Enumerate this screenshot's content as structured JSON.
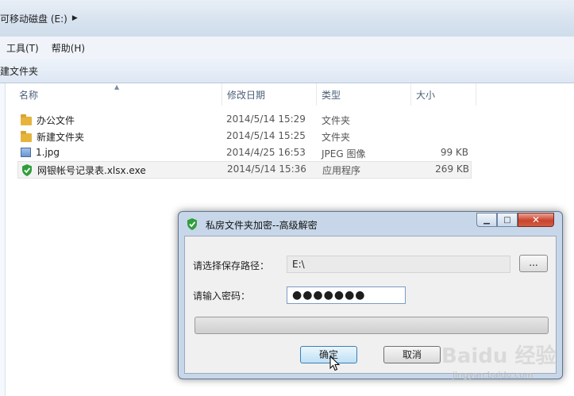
{
  "address_bar": {
    "crumb": "可移动磁盘 (E:)"
  },
  "menu": [
    {
      "label": "工具(T)"
    },
    {
      "label": "帮助(H)"
    }
  ],
  "toolbar": {
    "new_folder_label": "建文件夹"
  },
  "columns": {
    "name": "名称",
    "date": "修改日期",
    "type": "类型",
    "size": "大小"
  },
  "files": [
    {
      "name": "办公文件",
      "date": "2014/5/14 15:29",
      "type": "文件夹",
      "size": "",
      "icon": "folder-icon"
    },
    {
      "name": "新建文件夹",
      "date": "2014/5/14 15:25",
      "type": "文件夹",
      "size": "",
      "icon": "folder-icon"
    },
    {
      "name": "1.jpg",
      "date": "2014/4/25 16:53",
      "type": "JPEG 图像",
      "size": "99 KB",
      "icon": "image-file-icon"
    },
    {
      "name": "网银帐号记录表.xlsx.exe",
      "date": "2014/5/14 15:36",
      "type": "应用程序",
      "size": "269 KB",
      "icon": "green-shield-icon"
    }
  ],
  "dialog": {
    "title": "私房文件夹加密--高级解密",
    "path_label": "请选择保存路径：",
    "path_value": "E:\\",
    "browse_label": "...",
    "password_label": "请输入密码：",
    "password_value": "●●●●●●●",
    "progress": 0,
    "ok_label": "确定",
    "cancel_label": "取消"
  },
  "watermark": {
    "brand": "Baidu 经验",
    "url": "jingyan.baidu.com"
  },
  "colors": {
    "accent": "#3c7fb1",
    "shield": "#2e9e3a",
    "folder": "#e6b43c"
  }
}
